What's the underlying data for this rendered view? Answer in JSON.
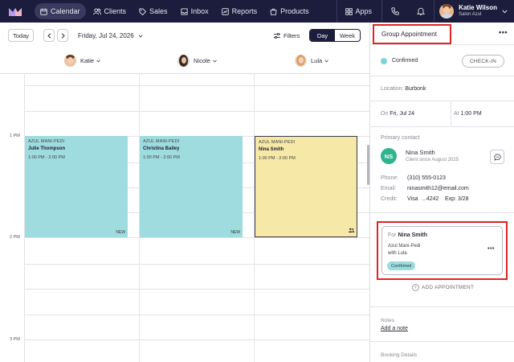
{
  "nav": {
    "items": [
      {
        "label": "Calendar",
        "icon": "calendar-icon",
        "active": true
      },
      {
        "label": "Clients",
        "icon": "users-icon"
      },
      {
        "label": "Sales",
        "icon": "tag-icon"
      },
      {
        "label": "Inbox",
        "icon": "inbox-icon"
      },
      {
        "label": "Reports",
        "icon": "chart-icon"
      },
      {
        "label": "Products",
        "icon": "bag-icon"
      }
    ],
    "apps_label": "Apps",
    "user_name": "Katie Wilson",
    "user_business": "Salon Azul"
  },
  "toolbar": {
    "today_label": "Today",
    "date_label": "Friday, Jul 24, 2026",
    "filters_label": "Filters",
    "day_label": "Day",
    "week_label": "Week"
  },
  "staff": [
    {
      "name": "Katie"
    },
    {
      "name": "Nicole"
    },
    {
      "name": "Lula"
    }
  ],
  "times": [
    "1 PM",
    "2 PM",
    "3 PM"
  ],
  "appointments": [
    {
      "service": "AZUL MANI-PEDI",
      "client": "Julie Thompson",
      "time": "1:00 PM - 2:00 PM",
      "tag": "NEW",
      "color": "#9fdcdf"
    },
    {
      "service": "AZUL MANI-PEDI",
      "client": "Christina Bailey",
      "time": "1:00 PM - 2:00 PM",
      "tag": "NEW",
      "color": "#9fdcdf"
    },
    {
      "service": "AZUL MANI-PEDI",
      "client": "Nina Smith",
      "time": "1:00 PM - 2:00 PM",
      "tag": "",
      "color": "#f6e8a6"
    }
  ],
  "panel": {
    "title": "Group Appointment",
    "status": "Confirmed",
    "checkin_label": "CHECK-IN",
    "location_label": "Location:",
    "location_value": "Burbonk",
    "on_label": "On",
    "on_value": "Fri, Jul 24",
    "at_label": "At",
    "at_value": "1:00 PM",
    "primary_contact_label": "Primary contact",
    "contact_initials": "NS",
    "contact_name": "Nina Smith",
    "contact_since": "Client since August 2025",
    "phone_label": "Phone:",
    "phone_value": "(310) 555-0123",
    "email_label": "Email:",
    "email_value": "ninasmith12@email.com",
    "credit_label": "Credit:",
    "credit_brand": "Visa",
    "credit_last4": "...4242",
    "credit_exp": "Exp: 3/28",
    "card": {
      "for_label": "For",
      "for_name": "Nina Smith",
      "service": "Azul Mani-Pedi",
      "with": "with Lula",
      "status": "Confirmed"
    },
    "add_appointment_label": "ADD APPOINTMENT",
    "notes_label": "Notes",
    "add_note_label": "Add a note",
    "booking_details_label": "Booking Details"
  },
  "colors": {
    "nav_bg": "#1c1c3c",
    "appt_teal": "#9fdcdf",
    "appt_yellow": "#f6e8a6",
    "confirmed_dot": "#7fd3d6",
    "highlight_red": "#e02424",
    "contact_green": "#2fb58e"
  }
}
